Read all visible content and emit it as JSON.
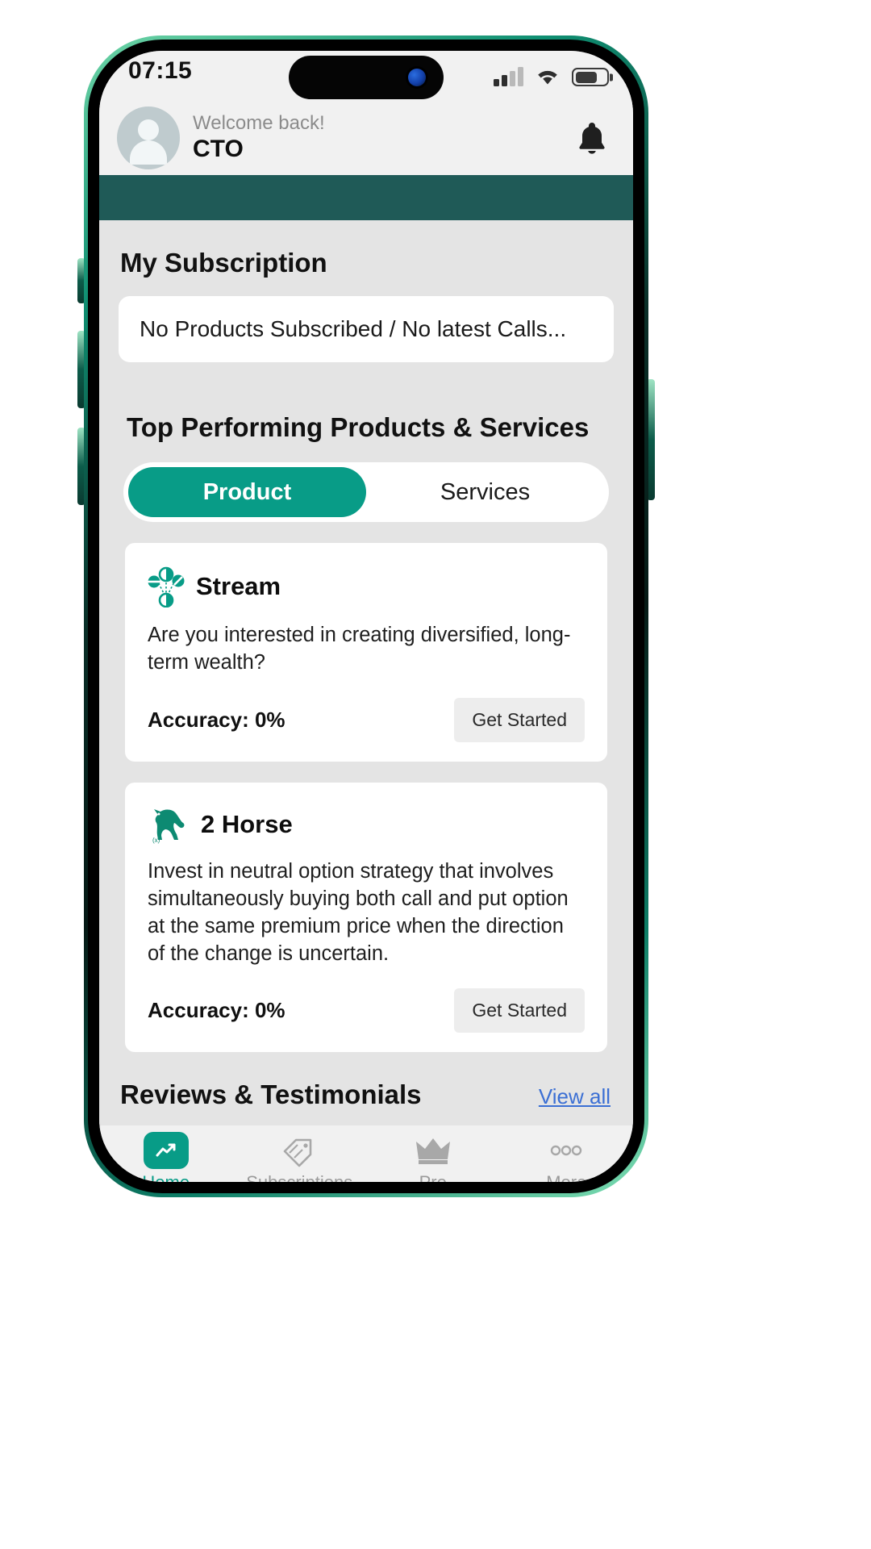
{
  "status_bar": {
    "time": "07:15",
    "signal_icon": "signal-bars-icon",
    "signal_bars_filled": 2,
    "signal_bars_total": 4,
    "wifi_icon": "wifi-icon",
    "battery_icon": "battery-icon",
    "battery_percent": 65
  },
  "header": {
    "avatar_icon": "user-avatar-icon",
    "greeting": "Welcome back!",
    "username": "CTO",
    "notification_icon": "bell-icon"
  },
  "subscription": {
    "title": "My Subscription",
    "empty_message": "No Products Subscribed / No latest Calls..."
  },
  "top_performing": {
    "title": "Top Performing Products & Services",
    "tabs": [
      {
        "label": "Product",
        "active": true
      },
      {
        "label": "Services",
        "active": false
      }
    ],
    "cards": [
      {
        "icon": "stream-network-icon",
        "title": "Stream",
        "description": "Are you interested in creating diversified, long-term wealth?",
        "accuracy_label": "Accuracy: 0%",
        "cta_label": "Get Started"
      },
      {
        "icon": "horse-icon",
        "title": "2 Horse",
        "description": "Invest in neutral option strategy that involves simultaneously buying both call and put option at the same premium price when the direction of the change is uncertain.",
        "accuracy_label": "Accuracy: 0%",
        "cta_label": "Get Started"
      }
    ]
  },
  "reviews": {
    "title": "Reviews & Testimonials",
    "view_all_label": "View all"
  },
  "bottom_nav": [
    {
      "label": "Home",
      "icon": "home-chart-icon",
      "active": true
    },
    {
      "label": "Subscriptions",
      "icon": "tag-icon",
      "active": false
    },
    {
      "label": "Pro",
      "icon": "crown-icon",
      "active": false
    },
    {
      "label": "More",
      "icon": "dots-icon",
      "active": false
    }
  ],
  "colors": {
    "accent_teal": "#089c87",
    "banner_teal": "#1f5a57",
    "background": "#e4e4e4",
    "link_blue": "#3b6fd4"
  }
}
